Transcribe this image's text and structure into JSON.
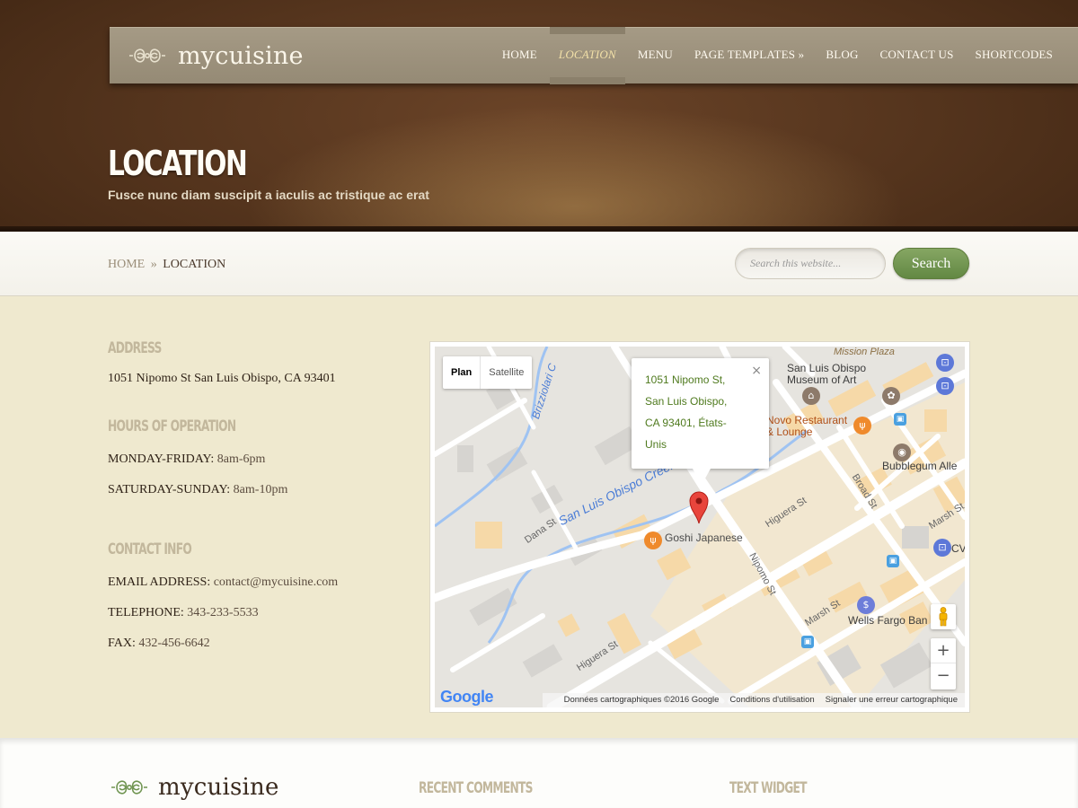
{
  "header": {
    "logo_text": "mycuisine",
    "nav": [
      {
        "label": "HOME",
        "active": false
      },
      {
        "label": "LOCATION",
        "active": true
      },
      {
        "label": "MENU",
        "active": false
      },
      {
        "label": "PAGE TEMPLATES »",
        "active": false
      },
      {
        "label": "BLOG",
        "active": false
      },
      {
        "label": "CONTACT US",
        "active": false
      },
      {
        "label": "SHORTCODES",
        "active": false
      }
    ],
    "page_title": "LOCATION",
    "page_subtitle": "Fusce nunc diam suscipit a iaculis ac tristique ac erat"
  },
  "breadcrumb": {
    "home": "HOME",
    "separator": "»",
    "current": "LOCATION"
  },
  "search": {
    "placeholder": "Search this website...",
    "button_label": "Search"
  },
  "sections": {
    "address": {
      "heading": "ADDRESS",
      "text": "1051 Nipomo St San Luis Obispo, CA 93401"
    },
    "hours": {
      "heading": "HOURS OF OPERATION",
      "weekday_label": "MONDAY-FRIDAY:",
      "weekday_value": "8am-6pm",
      "weekend_label": "SATURDAY-SUNDAY:",
      "weekend_value": "8am-10pm"
    },
    "contact": {
      "heading": "CONTACT INFO",
      "email_label": "EMAIL ADDRESS:",
      "email_value": "contact@mycuisine.com",
      "phone_label": "TELEPHONE:",
      "phone_value": "343-233-5533",
      "fax_label": "FAX:",
      "fax_value": "432-456-6642"
    }
  },
  "map": {
    "type_plan": "Plan",
    "type_satellite": "Satellite",
    "info_window_text": "1051 Nipomo St,\nSan Luis Obispo,\nCA 93401, États-\nUnis",
    "close_symbol": "×",
    "labels": {
      "mission_plaza": "Mission Plaza",
      "museum": "San Luis Obispo\nMuseum of Art",
      "novo": "Novo Restaurant\n& Lounge",
      "bubblegum": "Bubblegum Alle",
      "goshi": "Goshi Japanese",
      "wells_fargo": "Wells Fargo Ban",
      "creek": "San Luis Obispo Creek",
      "brizziolari": "Brizziolari C",
      "dana": "Dana St",
      "higuera_top": "Higuera St",
      "higuera_bottom": "Higuera St",
      "nipomo": "Nipomo St",
      "marsh": "Marsh St",
      "marsh_right": "Marsh St",
      "broad": "Broad St",
      "cv": "CV"
    },
    "google_logo": "Google",
    "attribution": {
      "data": "Données cartographiques ©2016 Google",
      "terms": "Conditions d'utilisation",
      "report": "Signaler une erreur cartographique"
    },
    "zoom_in": "+",
    "zoom_out": "−"
  },
  "footer": {
    "logo_text": "mycuisine",
    "recent_comments": "RECENT COMMENTS",
    "text_widget": "TEXT WIDGET"
  },
  "colors": {
    "accent_green": "#6f9450",
    "heading_tan": "#c2b79c",
    "map_text_green": "#4f7a1e"
  }
}
